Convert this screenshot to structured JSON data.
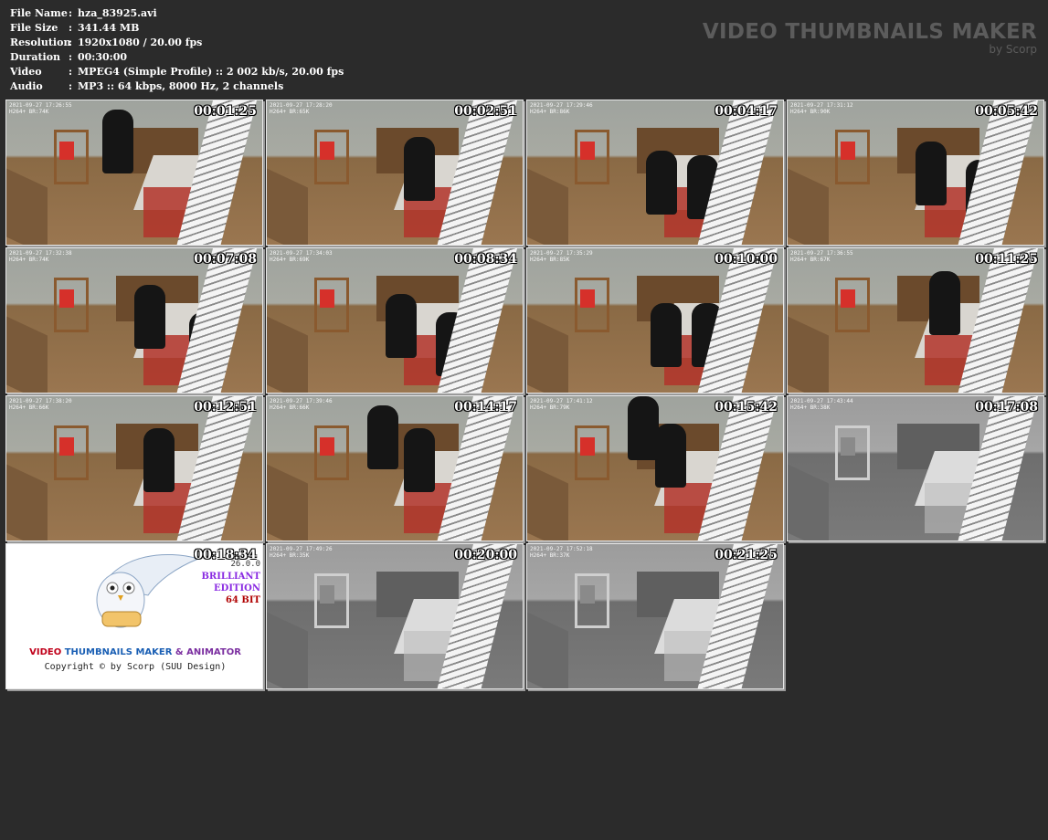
{
  "info": [
    {
      "label": "File Name",
      "value": "hza_83925.avi"
    },
    {
      "label": "File Size",
      "value": "341.44 MB"
    },
    {
      "label": "Resolution",
      "value": "1920x1080 / 20.00 fps"
    },
    {
      "label": "Duration",
      "value": "00:30:00"
    },
    {
      "label": "Video",
      "value": "MPEG4 (Simple Profile) :: 2 002 kb/s, 20.00 fps"
    },
    {
      "label": "Audio",
      "value": "MP3 :: 64 kbps, 8000 Hz, 2 channels"
    }
  ],
  "separator": ":",
  "brand": {
    "title": "VIDEO THUMBNAILS MAKER",
    "subtitle": "by Scorp"
  },
  "thumbnails": [
    {
      "time": "00:01:25",
      "osd_date": "2021-09-27 17:26:55",
      "osd_info": "H264+ BR:74K",
      "mode": "color"
    },
    {
      "time": "00:02:51",
      "osd_date": "2021-09-27 17:28:20",
      "osd_info": "H264+ BR:65K",
      "mode": "color"
    },
    {
      "time": "00:04:17",
      "osd_date": "2021-09-27 17:29:46",
      "osd_info": "H264+ BR:86K",
      "mode": "color"
    },
    {
      "time": "00:05:42",
      "osd_date": "2021-09-27 17:31:12",
      "osd_info": "H264+ BR:90K",
      "mode": "color"
    },
    {
      "time": "00:07:08",
      "osd_date": "2021-09-27 17:32:38",
      "osd_info": "H264+ BR:74K",
      "mode": "color"
    },
    {
      "time": "00:08:34",
      "osd_date": "2021-09-27 17:34:03",
      "osd_info": "H264+ BR:69K",
      "mode": "color"
    },
    {
      "time": "00:10:00",
      "osd_date": "2021-09-27 17:35:29",
      "osd_info": "H264+ BR:85K",
      "mode": "color"
    },
    {
      "time": "00:11:25",
      "osd_date": "2021-09-27 17:36:55",
      "osd_info": "H264+ BR:67K",
      "mode": "color"
    },
    {
      "time": "00:12:51",
      "osd_date": "2021-09-27 17:38:20",
      "osd_info": "H264+ BR:66K",
      "mode": "color"
    },
    {
      "time": "00:14:17",
      "osd_date": "2021-09-27 17:39:46",
      "osd_info": "H264+ BR:66K",
      "mode": "color"
    },
    {
      "time": "00:15:42",
      "osd_date": "2021-09-27 17:41:12",
      "osd_info": "H264+ BR:79K",
      "mode": "color"
    },
    {
      "time": "00:17:08",
      "osd_date": "2021-09-27 17:43:44",
      "osd_info": "H264+ BR:38K",
      "mode": "gray"
    },
    {
      "time": "00:18:34",
      "mode": "logo"
    },
    {
      "time": "00:20:00",
      "osd_date": "2021-09-27 17:49:26",
      "osd_info": "H264+ BR:35K",
      "mode": "gray"
    },
    {
      "time": "00:21:25",
      "osd_date": "2021-09-27 17:52:18",
      "osd_info": "H264+ BR:37K",
      "mode": "gray"
    }
  ],
  "logo": {
    "title_part1": "VIDEO",
    "title_part2": "THUMBNAILS MAKER",
    "title_part3": "& ANIMATOR",
    "copyright": "Copyright © by Scorp (SUU Design)",
    "version": "26.0.0",
    "edition_line1": "BRILLIANT",
    "edition_line2": "EDITION",
    "edition_line3": "64 BIT",
    "colors": {
      "video": "#c0001a",
      "thumbnails": "#1a5fb4",
      "animator": "#7b2fa0",
      "edition": "#8a2be2",
      "bit": "#b00000"
    }
  }
}
